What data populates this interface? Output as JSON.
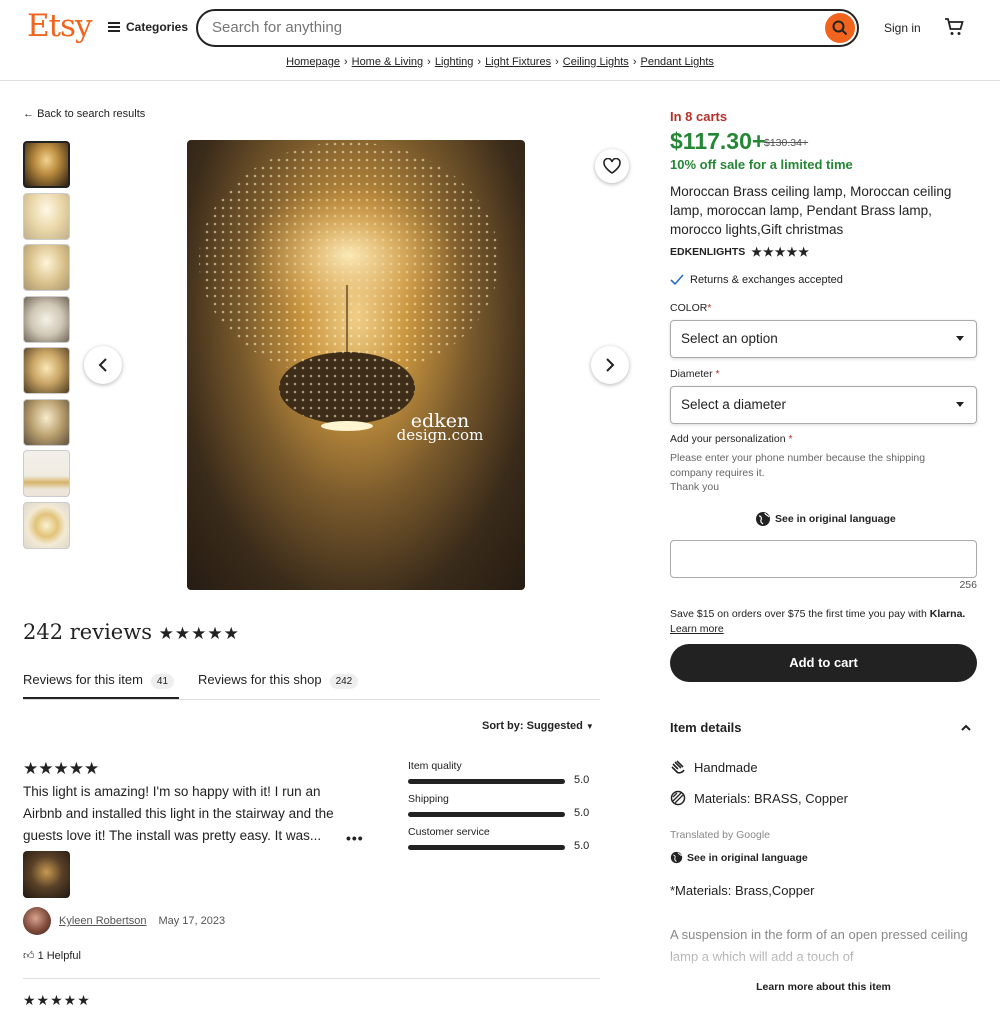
{
  "header": {
    "logo": "Etsy",
    "categories_label": "Categories",
    "search_placeholder": "Search for anything",
    "signin_label": "Sign in"
  },
  "breadcrumb": [
    "Homepage",
    "Home & Living",
    "Lighting",
    "Light Fixtures",
    "Ceiling Lights",
    "Pendant Lights"
  ],
  "back_label": "Back to search results",
  "image_watermark": {
    "line1": "edken",
    "line2": "design.com"
  },
  "reviews": {
    "heading": "242 reviews",
    "stars": "★★★★★",
    "tab_item_label": "Reviews for this item",
    "tab_item_count": "41",
    "tab_shop_label": "Reviews for this shop",
    "tab_shop_count": "242",
    "sort_label": "Sort by: Suggested",
    "review": {
      "stars": "★★★★★",
      "text": "This light is amazing! I'm so happy with it! I run an Airbnb and installed this light in the stairway and the guests love it! The install was pretty easy. It was...",
      "more": "•••",
      "author": "Kyleen Robertson",
      "date": "May 17, 2023",
      "helpful": "1 Helpful"
    },
    "next_stars": "★★★★★",
    "metrics": [
      {
        "label": "Item quality",
        "value": "5.0",
        "fraction": 1.0
      },
      {
        "label": "Shipping",
        "value": "5.0",
        "fraction": 1.0
      },
      {
        "label": "Customer service",
        "value": "5.0",
        "fraction": 1.0
      }
    ]
  },
  "product": {
    "in_carts": "In 8 carts",
    "price": "$117.30+",
    "old_price": "$130.34+",
    "sale": "10% off sale for a limited time",
    "title": "Moroccan Brass ceiling lamp, Moroccan ceiling lamp, moroccan lamp, Pendant Brass lamp, morocco lights,Gift christmas",
    "shop_name": "EDKENLIGHTS",
    "shop_stars": "★★★★★",
    "returns": "Returns & exchanges accepted",
    "color_label": "COLOR",
    "color_select": "Select an option",
    "diameter_label": "Diameter",
    "diameter_select": "Select a diameter",
    "personalization_label": "Add your personalization",
    "personalization_hint": "Please enter your phone number because the shipping company requires it.",
    "personalization_thanks": "Thank you",
    "see_original": "See in original language",
    "char_count": "256",
    "klarna_text": "Save $15 on orders over $75 the first time you pay with",
    "klarna_brand": "Klarna.",
    "learn_more": "Learn more",
    "add_to_cart": "Add to cart",
    "item_details": "Item details",
    "handmade": "Handmade",
    "materials": "Materials: BRASS, Copper",
    "translated_by": "Translated by Google",
    "see_original2": "See in original language",
    "materials_desc": "*Materials: Brass,Copper",
    "description": "A suspension in the form of an open pressed ceiling lamp a which will add a touch of",
    "learn_item": "Learn more about this item"
  },
  "colors": {
    "brand": "#f1641e",
    "price_green": "#258635",
    "alert_red": "#b4312a",
    "dark": "#222222"
  }
}
